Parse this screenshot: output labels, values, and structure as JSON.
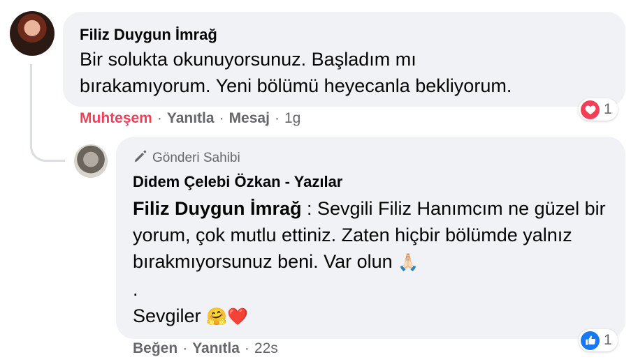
{
  "comment": {
    "author": "Filiz Duygun İmrağ",
    "text_line1": "Bir solukta okunuyorsunuz. Başladım mı",
    "text_line2": "bırakamıyorum. Yeni bölümü heyecanla bekliyorum.",
    "reaction_label": "Muhteşem",
    "reply_label": "Yanıtla",
    "message_label": "Mesaj",
    "time": "1g",
    "reaction_icon": "love-icon",
    "reaction_count": "1"
  },
  "reply": {
    "owner_badge": "Gönderi Sahibi",
    "author": "Didem Çelebi Özkan - Yazılar",
    "mention": "Filiz Duygun İmrağ",
    "text_main": " : Sevgili Filiz Hanımcım ne güzel bir yorum, çok mutlu ettiniz. Zaten hiçbir bölümde yalnız bırakmıyorsunuz beni. Var olun",
    "pray_emoji": "🙏🏻",
    "dot_line": ".",
    "closing": "Sevgiler",
    "closing_emojis": "🤗❤️",
    "like_label": "Beğen",
    "reply_label": "Yanıtla",
    "time": "22s",
    "reaction_icon": "like-icon",
    "reaction_count": "1"
  },
  "colors": {
    "bubble": "#f0f2f5",
    "secondary_text": "#65676b",
    "love": "#f33e58",
    "like": "#1877f2"
  }
}
